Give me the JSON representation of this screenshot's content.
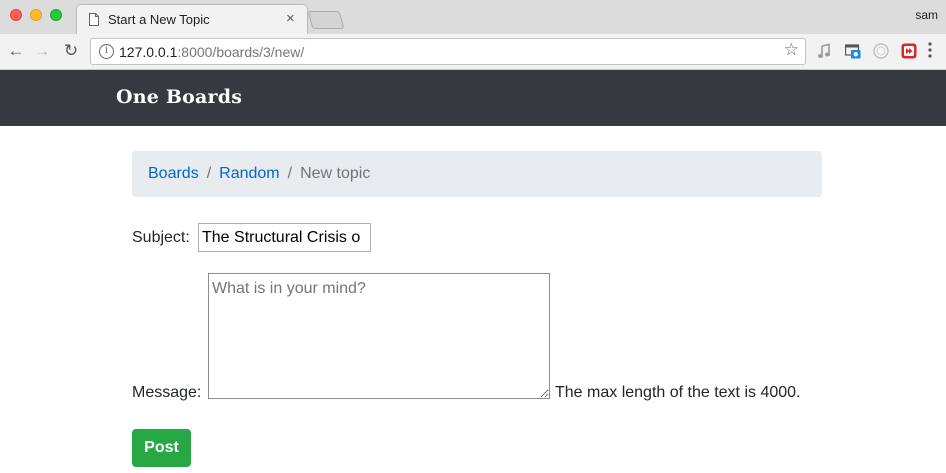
{
  "browser": {
    "tab_title": "Start a New Topic",
    "tab_close": "×",
    "profile_name": "sam",
    "url_host": "127.0.0.1",
    "url_path": ":8000/boards/3/new/",
    "nav_back": "←",
    "nav_forward": "→",
    "nav_reload": "↻",
    "star": "☆",
    "info": "i"
  },
  "navbar": {
    "brand": "One Boards",
    "background": "#343a40"
  },
  "breadcrumb": {
    "items": [
      "Boards",
      "Random"
    ],
    "separator": "/",
    "active": "New topic",
    "link_color": "#0065d9"
  },
  "form": {
    "subject_label": "Subject:",
    "subject_value": "The Structural Crisis o",
    "message_label": "Message:",
    "message_placeholder": "What is in your mind?",
    "help_text": "The max length of the text is 4000.",
    "submit_label": "Post",
    "submit_color": "#28a745"
  },
  "icons": {
    "tab": "document-icon",
    "extensions": [
      "music-extension-icon",
      "screenshot-extension-icon",
      "circle-extension-icon",
      "red-play-extension-icon"
    ],
    "menu": "more-vertical-icon"
  }
}
